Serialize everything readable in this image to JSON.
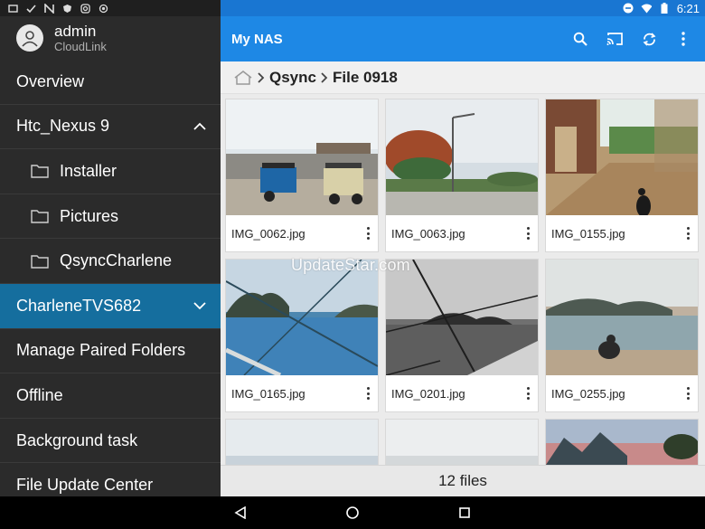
{
  "status_bar": {
    "time": "6:21"
  },
  "drawer": {
    "user": {
      "name": "admin",
      "subtitle": "CloudLink"
    },
    "items": [
      {
        "label": "Overview"
      },
      {
        "label": "Htc_Nexus 9",
        "expanded": true
      },
      {
        "label": "Installer",
        "sub": true
      },
      {
        "label": "Pictures",
        "sub": true
      },
      {
        "label": "QsyncCharlene",
        "sub": true
      },
      {
        "label": "CharleneTVS682",
        "active": true
      },
      {
        "label": "Manage Paired Folders"
      },
      {
        "label": "Offline"
      },
      {
        "label": "Background task"
      },
      {
        "label": "File Update Center"
      }
    ]
  },
  "appbar": {
    "title": "My NAS",
    "actions": [
      "search-icon",
      "cast-icon",
      "sync-icon",
      "overflow-menu-icon"
    ]
  },
  "breadcrumb": {
    "home_icon": "home-icon",
    "parts": [
      "Qsync",
      "File 0918"
    ]
  },
  "files": [
    {
      "name": "IMG_0062.jpg"
    },
    {
      "name": "IMG_0063.jpg"
    },
    {
      "name": "IMG_0155.jpg"
    },
    {
      "name": "IMG_0165.jpg"
    },
    {
      "name": "IMG_0201.jpg"
    },
    {
      "name": "IMG_0255.jpg"
    }
  ],
  "watermark": "UpdateStar.com",
  "footer": {
    "count_label": "12 files"
  },
  "colors": {
    "appbar": "#1e88e5",
    "drawer_bg": "#2b2b2b",
    "drawer_active": "#156e9e"
  }
}
